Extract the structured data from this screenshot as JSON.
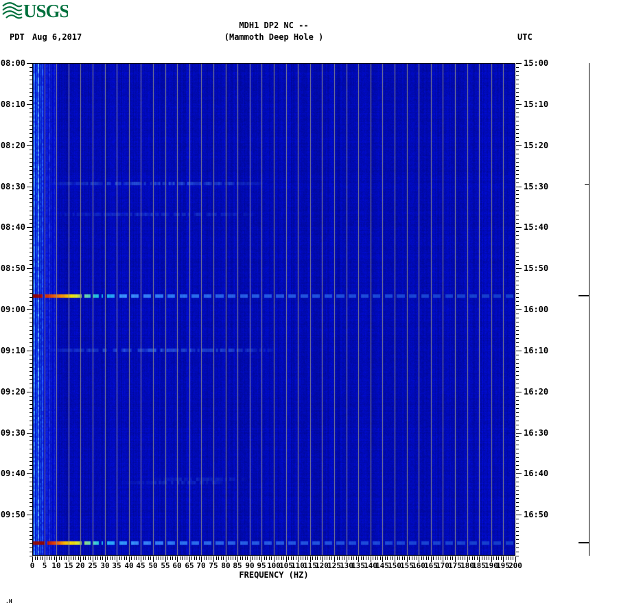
{
  "logo": {
    "text": "USGS",
    "color": "#00703C"
  },
  "header": {
    "timezone_left": "PDT",
    "date": "Aug 6,2017",
    "title": "MDH1 DP2 NC --",
    "subtitle": "(Mammoth Deep Hole )",
    "timezone_right": "UTC"
  },
  "footnote": ".H",
  "chart_data": {
    "type": "heatmap",
    "subtype": "seismic-spectrogram",
    "title": "MDH1 DP2 NC -- (Mammoth Deep Hole )",
    "station": "MDH1 DP2 NC",
    "site_name": "Mammoth Deep Hole",
    "date": "Aug 6,2017",
    "xlabel": "FREQUENCY (HZ)",
    "x_range_hz": [
      0,
      200
    ],
    "x_tick_step_hz": 5,
    "x_minor_tick_step_hz": 1,
    "x_tick_labels": [
      "0",
      "5",
      "10",
      "15",
      "20",
      "25",
      "30",
      "35",
      "40",
      "45",
      "50",
      "55",
      "60",
      "65",
      "70",
      "75",
      "80",
      "85",
      "90",
      "95",
      "100",
      "105",
      "110",
      "115",
      "120",
      "125",
      "130",
      "135",
      "140",
      "145",
      "150",
      "155",
      "160",
      "165",
      "170",
      "175",
      "180",
      "185",
      "190",
      "195",
      "200"
    ],
    "grid": {
      "vertical_line_every_hz": 5,
      "color": "#8c8c8c"
    },
    "duration_minutes": 120,
    "minor_tick_every_min": 1,
    "left_axis": {
      "timezone": "PDT",
      "tick_every_min": 10,
      "tick_labels": [
        "08:00",
        "08:10",
        "08:20",
        "08:30",
        "08:40",
        "08:50",
        "09:00",
        "09:10",
        "09:20",
        "09:30",
        "09:40",
        "09:50"
      ]
    },
    "right_axis": {
      "timezone": "UTC",
      "tick_every_min": 10,
      "tick_labels": [
        "15:00",
        "15:10",
        "15:20",
        "15:30",
        "15:40",
        "15:50",
        "16:00",
        "16:10",
        "16:20",
        "16:30",
        "16:40",
        "16:50"
      ]
    },
    "background_color": "#000ab4",
    "low_freq_noise_stripes": [
      {
        "hz": 0.7,
        "color": "#55ccff",
        "w": 2
      },
      {
        "hz": 1.6,
        "color": "#1f8fff",
        "w": 1
      },
      {
        "hz": 2.4,
        "color": "#7fe0ff",
        "w": 2
      },
      {
        "hz": 3.3,
        "color": "#2f9fff",
        "w": 1
      },
      {
        "hz": 4.1,
        "color": "#3377ff",
        "w": 2
      },
      {
        "hz": 5.0,
        "color": "#2255ee",
        "w": 1
      },
      {
        "hz": 5.9,
        "color": "#3366ff",
        "w": 1
      },
      {
        "hz": 6.8,
        "color": "#2b49e8",
        "w": 2
      },
      {
        "hz": 7.8,
        "color": "#2440dd",
        "w": 1
      },
      {
        "hz": 9.0,
        "color": "#1f35cf",
        "w": 1
      }
    ],
    "events": [
      {
        "label": "broadband event 08:56 PDT / 15:56 UTC",
        "minute": 56.7,
        "gaps_hz": [
          [
            4.1,
            4.9
          ]
        ],
        "color_stops": [
          [
            0,
            "#8b0000"
          ],
          [
            3,
            "#a00000"
          ],
          [
            4.5,
            "#cc2200"
          ],
          [
            6,
            "#dd3300"
          ],
          [
            8,
            "#ee5500"
          ],
          [
            10,
            "#ff7700"
          ],
          [
            13,
            "#ffaa00"
          ],
          [
            16,
            "#ffee00"
          ],
          [
            19,
            "#cbe94a"
          ],
          [
            22,
            "#74ddaa"
          ],
          [
            26,
            "#27ccdd"
          ],
          [
            30,
            "#18bbee"
          ],
          [
            36,
            "#3d99ff"
          ],
          [
            45,
            "#3a88fa"
          ],
          [
            60,
            "#2d77f2"
          ],
          [
            80,
            "#2b66e8"
          ],
          [
            110,
            "#2458e2"
          ],
          [
            150,
            "#1c4ad8"
          ],
          [
            200,
            "#1640cc"
          ]
        ]
      },
      {
        "label": "broadband event 09:57 PDT / 16:57 UTC",
        "minute": 116.8,
        "gaps_hz": [
          [
            5.3,
            6.0
          ]
        ],
        "color_stops": [
          [
            0,
            "#8b0000"
          ],
          [
            2,
            "#9a0a00"
          ],
          [
            5,
            "#8b0000"
          ],
          [
            7,
            "#cc2200"
          ],
          [
            9,
            "#ee4400"
          ],
          [
            11,
            "#ff7700"
          ],
          [
            14,
            "#ffcc00"
          ],
          [
            17,
            "#ffee00"
          ],
          [
            20,
            "#bbe955"
          ],
          [
            24,
            "#66ddbb"
          ],
          [
            28,
            "#22ccee"
          ],
          [
            34,
            "#33aaff"
          ],
          [
            45,
            "#3a88fa"
          ],
          [
            60,
            "#2d77f2"
          ],
          [
            80,
            "#2b66e8"
          ],
          [
            110,
            "#2458e2"
          ],
          [
            150,
            "#1c4ad8"
          ],
          [
            200,
            "#1640cc"
          ]
        ]
      }
    ],
    "weak_bands": [
      {
        "minute": 29.3,
        "from_hz": 7,
        "to_hz": 95,
        "alpha": 0.35
      },
      {
        "minute": 36.8,
        "from_hz": 9,
        "to_hz": 92,
        "alpha": 0.2
      },
      {
        "minute": 69.9,
        "from_hz": 7,
        "to_hz": 100,
        "alpha": 0.38
      },
      {
        "minute": 101.2,
        "from_hz": 50,
        "to_hz": 88,
        "alpha": 0.16
      },
      {
        "minute": 102.2,
        "from_hz": 37,
        "to_hz": 82,
        "alpha": 0.16
      }
    ],
    "amplitude_trace_spikes": [
      {
        "minute": 29.5,
        "size": "small"
      },
      {
        "minute": 56.7,
        "size": "large"
      },
      {
        "minute": 116.8,
        "size": "large"
      }
    ]
  }
}
